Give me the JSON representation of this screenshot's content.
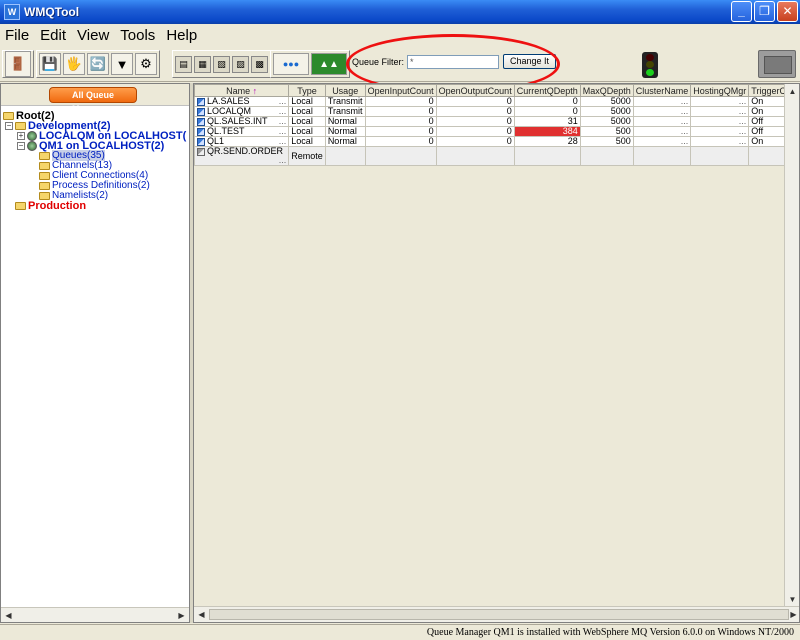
{
  "window": {
    "title": "WMQTool",
    "icon_text": "W"
  },
  "menu": [
    "File",
    "Edit",
    "View",
    "Tools",
    "Help"
  ],
  "queue_filter": {
    "label": "Queue Filter:",
    "value": "*",
    "button": "Change It"
  },
  "left_pane": {
    "button": "All Queue Managers",
    "tree": {
      "root": "Root(2)",
      "development": "Development(2)",
      "localqm": "LOCALQM on LOCALHOST(",
      "qm1": "QM1 on LOCALHOST(2)",
      "queues": "Queues(35)",
      "channels": "Channels(13)",
      "client_connections": "Client Connections(4)",
      "process_definitions": "Process Definitions(2)",
      "namelists": "Namelists(2)",
      "production": "Production"
    }
  },
  "table": {
    "columns": [
      "Name",
      "Type",
      "Usage",
      "OpenInputCount",
      "OpenOutputCount",
      "CurrentQDepth",
      "MaxQDepth",
      "ClusterName",
      "HostingQMgr",
      "TriggerCon"
    ],
    "sort_indicator": "↑",
    "rows": [
      {
        "name": "LA.SALES",
        "type": "Local",
        "usage": "Transmit",
        "open_in": "0",
        "open_out": "0",
        "depth": "0",
        "max": "5000",
        "cluster": "...",
        "hosting": "...",
        "trigger": "On"
      },
      {
        "name": "LOCALQM",
        "type": "Local",
        "usage": "Transmit",
        "open_in": "0",
        "open_out": "0",
        "depth": "0",
        "max": "5000",
        "cluster": "...",
        "hosting": "...",
        "trigger": "On"
      },
      {
        "name": "QL.SALES.INT",
        "type": "Local",
        "usage": "Normal",
        "open_in": "0",
        "open_out": "0",
        "depth": "31",
        "max": "5000",
        "cluster": "...",
        "hosting": "...",
        "trigger": "Off"
      },
      {
        "name": "QL.TEST",
        "type": "Local",
        "usage": "Normal",
        "open_in": "0",
        "open_out": "0",
        "depth": "384",
        "max": "500",
        "cluster": "...",
        "hosting": "...",
        "trigger": "Off"
      },
      {
        "name": "QL1",
        "type": "Local",
        "usage": "Normal",
        "open_in": "0",
        "open_out": "0",
        "depth": "28",
        "max": "500",
        "cluster": "...",
        "hosting": "...",
        "trigger": "On"
      },
      {
        "name": "QR.SEND.ORDER",
        "type": "Remote",
        "usage": "",
        "open_in": "",
        "open_out": "",
        "depth": "",
        "max": "",
        "cluster": "",
        "hosting": "",
        "trigger": ""
      }
    ]
  },
  "colors": {
    "highlight_depth": "#e03030",
    "annotation_ellipse": "#e11111",
    "title_bar": "#0a48c8"
  },
  "status": "Queue Manager QM1 is installed with WebSphere MQ Version 6.0.0 on Windows NT/2000"
}
